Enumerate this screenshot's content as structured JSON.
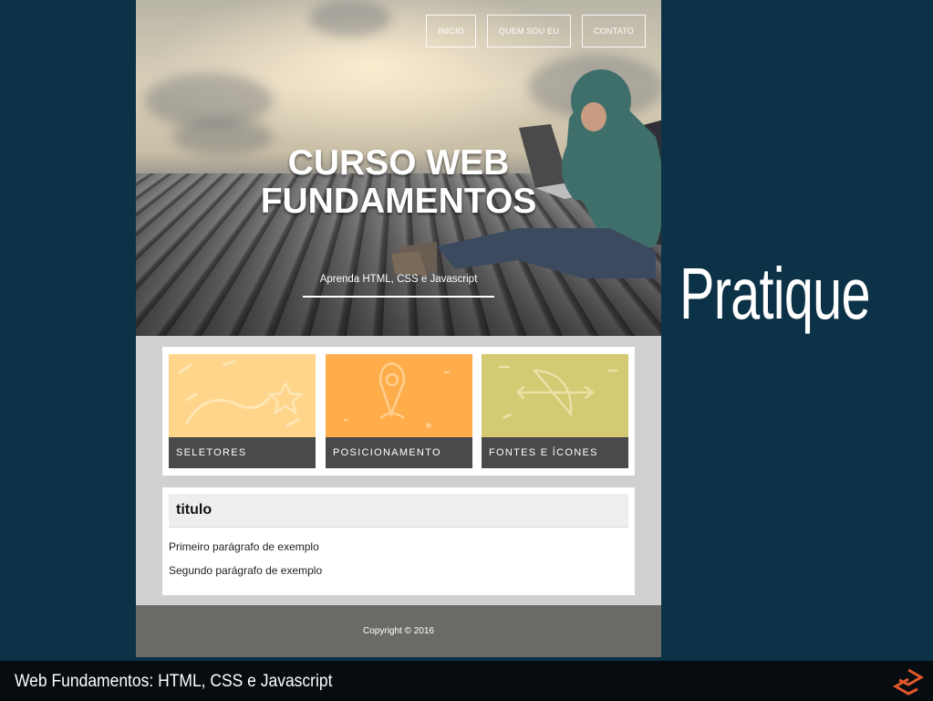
{
  "slide": {
    "heading": "Pratique",
    "caption": "Web Fundamentos: HTML, CSS e Javascript"
  },
  "site": {
    "nav": [
      "INÍCIO",
      "QUEM SOU EU",
      "CONTATO"
    ],
    "hero": {
      "title_line1": "CURSO WEB",
      "title_line2": "FUNDAMENTOS",
      "subtitle": "Aprenda HTML, CSS e Javascript"
    },
    "cards": [
      {
        "label": "SELETORES",
        "color": "#ffd58c",
        "icon": "path-star-icon"
      },
      {
        "label": "POSICIONAMENTO",
        "color": "#ffac4a",
        "icon": "location-pin-icon"
      },
      {
        "label": "FONTES E ÍCONES",
        "color": "#d4ca74",
        "icon": "bow-arrow-icon"
      }
    ],
    "content": {
      "title": "titulo",
      "paragraph1": "Primeiro parágrafo de exemplo",
      "paragraph2": "Segundo parágrafo de exemplo"
    },
    "footer": "Copyright © 2016"
  },
  "colors": {
    "slide_bg": "#0b3247",
    "footer_bg": "#6b6b66",
    "card_label_bg": "#4a4a4a"
  }
}
